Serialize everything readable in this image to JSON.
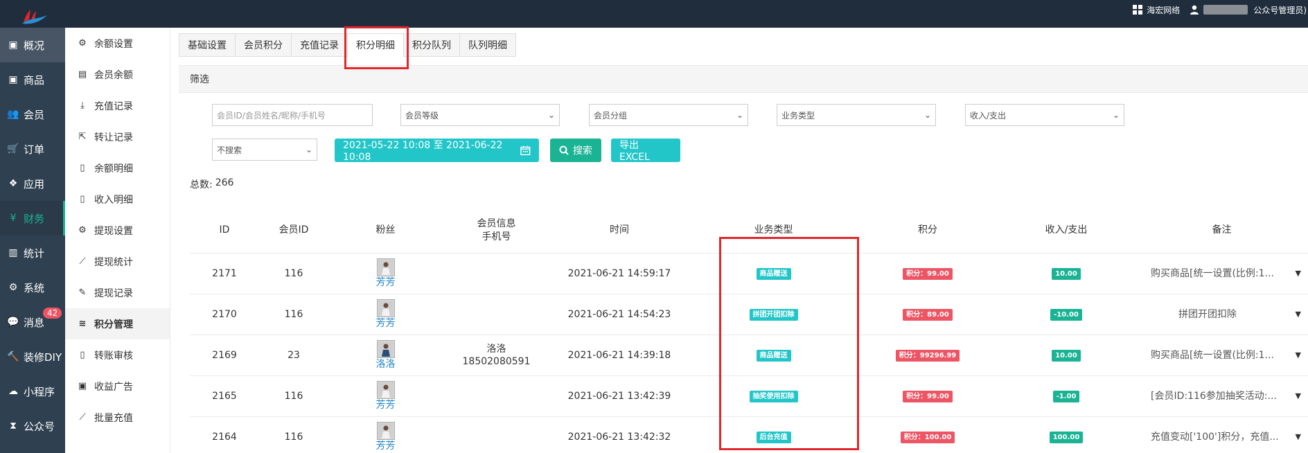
{
  "topbar": {
    "org": "海宏网络",
    "user_suffix": "公众号管理员)"
  },
  "leftnav": [
    {
      "label": "概况",
      "icon": "archive-icon"
    },
    {
      "label": "商品",
      "icon": "archive-icon"
    },
    {
      "label": "会员",
      "icon": "users-icon"
    },
    {
      "label": "订单",
      "icon": "cart-icon"
    },
    {
      "label": "应用",
      "icon": "cubes-icon"
    },
    {
      "label": "财务",
      "icon": "yen-icon"
    },
    {
      "label": "统计",
      "icon": "bar-chart-icon"
    },
    {
      "label": "系统",
      "icon": "cogs-icon"
    },
    {
      "label": "消息",
      "icon": "comment-icon",
      "badge": "42"
    },
    {
      "label": "装修DIY",
      "icon": "gavel-icon"
    },
    {
      "label": "小程序",
      "icon": "wechat-icon"
    },
    {
      "label": "公众号",
      "icon": "hourglass-icon"
    }
  ],
  "subnav": [
    {
      "label": "余额设置",
      "icon": "⚙"
    },
    {
      "label": "会员余额",
      "icon": "▤"
    },
    {
      "label": "充值记录",
      "icon": "⤓"
    },
    {
      "label": "转让记录",
      "icon": "⇱"
    },
    {
      "label": "余额明细",
      "icon": "▯"
    },
    {
      "label": "收入明细",
      "icon": "▯"
    },
    {
      "label": "提现设置",
      "icon": "⚙"
    },
    {
      "label": "提现统计",
      "icon": "⟋"
    },
    {
      "label": "提现记录",
      "icon": "✎"
    },
    {
      "label": "积分管理",
      "icon": "≋"
    },
    {
      "label": "转账审核",
      "icon": "▯"
    },
    {
      "label": "收益广告",
      "icon": "▣"
    },
    {
      "label": "批量充值",
      "icon": "⟋"
    }
  ],
  "tabs": [
    "基础设置",
    "会员积分",
    "充值记录",
    "积分明细",
    "积分队列",
    "队列明细"
  ],
  "filter": {
    "title": "筛选",
    "keyword_placeholder": "会员ID/会员姓名/昵称/手机号",
    "level": "会员等级",
    "group": "会员分组",
    "business": "业务类型",
    "inout": "收入/支出",
    "search_mode": "不搜索",
    "date_range": "2021-05-22 10:08 至 2021-06-22 10:08",
    "search_btn": "搜索",
    "export_btn": "导出 EXCEL"
  },
  "total": {
    "label": "总数:",
    "value": "266"
  },
  "table": {
    "headers": {
      "id": "ID",
      "member_id": "会员ID",
      "fans": "粉丝",
      "member_info": "会员信息",
      "phone": "手机号",
      "time": "时间",
      "biz": "业务类型",
      "points": "积分",
      "inout": "收入/支出",
      "note": "备注"
    },
    "rows": [
      {
        "id": "2171",
        "member_id": "116",
        "fan": "芳芳",
        "name": "",
        "phone": "",
        "time": "2021-06-21 14:59:17",
        "biz": "商品赠送",
        "points": "积分：99.00",
        "amount": "10.00",
        "amount_type": "primary",
        "note": "购买商品[统一设置(比例:1..."
      },
      {
        "id": "2170",
        "member_id": "116",
        "fan": "芳芳",
        "name": "",
        "phone": "",
        "time": "2021-06-21 14:54:23",
        "biz": "拼团开团扣除",
        "points": "积分：89.00",
        "amount": "-10.00",
        "amount_type": "primary",
        "note": "拼团开团扣除"
      },
      {
        "id": "2169",
        "member_id": "23",
        "fan": "洛洛",
        "name": "洛洛",
        "phone": "18502080591",
        "time": "2021-06-21 14:39:18",
        "biz": "商品赠送",
        "points": "积分：99296.99",
        "amount": "10.00",
        "amount_type": "primary",
        "note": "购买商品[统一设置(比例:1..."
      },
      {
        "id": "2165",
        "member_id": "116",
        "fan": "芳芳",
        "name": "",
        "phone": "",
        "time": "2021-06-21 13:42:39",
        "biz": "抽奖使用扣除",
        "points": "积分：99.00",
        "amount": "-1.00",
        "amount_type": "primary",
        "note": "[会员ID:116参加抽奖活动:..."
      },
      {
        "id": "2164",
        "member_id": "116",
        "fan": "芳芳",
        "name": "",
        "phone": "",
        "time": "2021-06-21 13:42:32",
        "biz": "后台充值",
        "points": "积分：100.00",
        "amount": "100.00",
        "amount_type": "primary",
        "note": "充值变动['100']积分，充值..."
      }
    ]
  },
  "colors": {
    "nav_bg": "#2f4050",
    "topbar_bg": "#1f2d3d",
    "accent": "#1ab394",
    "info": "#23c6c8",
    "danger": "#ed5565",
    "highlight": "#e3262b"
  }
}
